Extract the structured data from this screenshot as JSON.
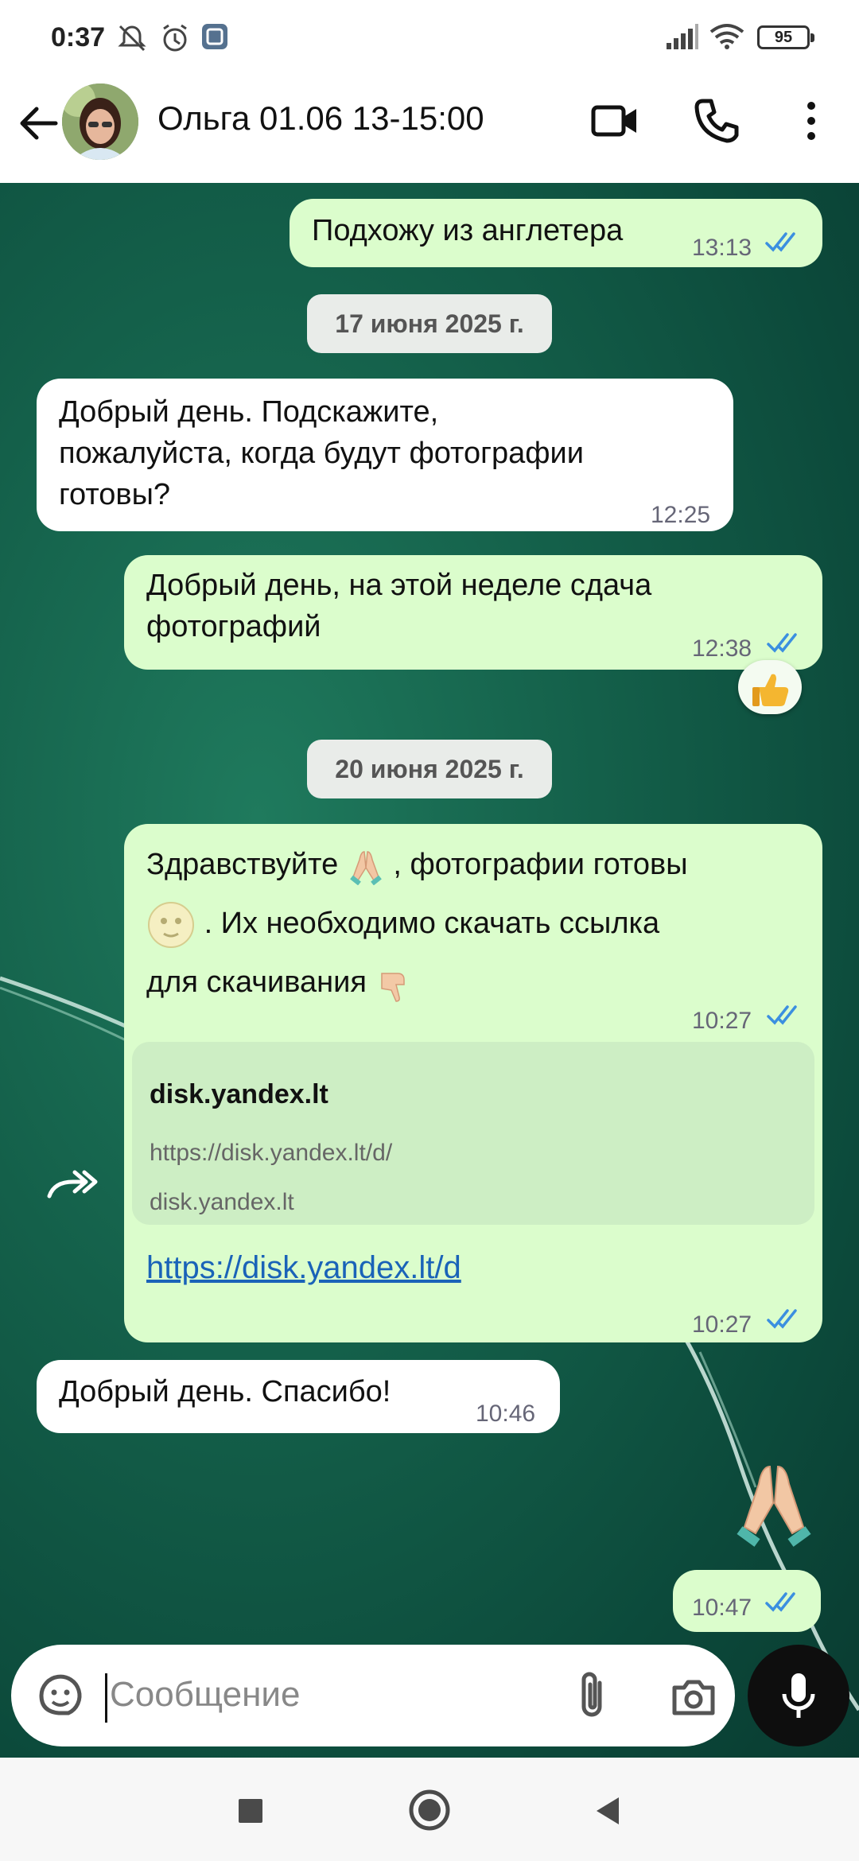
{
  "status_bar": {
    "time": "0:37",
    "battery": "95",
    "icons": [
      "notifications-off-icon",
      "alarm-icon",
      "gallery-icon",
      "signal-icon",
      "wifi-icon",
      "battery-icon"
    ]
  },
  "header": {
    "contact_name": "Ольга 01.06 13-15:00",
    "icons": [
      "back-arrow-icon",
      "avatar",
      "video-call-icon",
      "phone-icon",
      "more-vert-icon"
    ]
  },
  "messages": [
    {
      "direction": "out",
      "text": "Подхожу из англетера",
      "time": "13:13",
      "status": "read"
    },
    {
      "type": "date",
      "text": "17 июня 2025 г."
    },
    {
      "direction": "in",
      "text": "Добрый день.  Подскажите, пожалуйста,  когда будут фотографии готовы?",
      "lines": [
        "Добрый день.  Подскажите,",
        "пожалуйста,  когда будут фотографии",
        "готовы?"
      ],
      "time": "12:25"
    },
    {
      "direction": "out",
      "lines": [
        "Добрый день, на этой неделе сдача",
        "фотографий"
      ],
      "time": "12:38",
      "status": "read",
      "reaction": "thumbs-up"
    },
    {
      "type": "date",
      "text": "20 июня 2025 г."
    },
    {
      "direction": "out",
      "lines": [
        "Здравствуйте",
        ", фотографии готовы",
        ". Их необходимо скачать ссылка",
        "для скачивания"
      ],
      "time": "10:27",
      "status": "read"
    },
    {
      "direction": "out",
      "link_preview": {
        "title": "disk.yandex.lt",
        "url": "https://disk.yandex.lt/d/",
        "domain": "disk.yandex.lt"
      },
      "link": "https://disk.yandex.lt/d",
      "time": "10:27",
      "status": "read"
    },
    {
      "direction": "in",
      "text": "Добрый день. Спасибо!",
      "time": "10:46"
    },
    {
      "direction": "out",
      "emoji": "praying-hands",
      "time": "10:47",
      "status": "read"
    }
  ],
  "composer": {
    "placeholder": "Сообщение"
  },
  "nav_bar": {
    "buttons": [
      "recents-button",
      "home-button",
      "back-button"
    ]
  },
  "colors": {
    "outgoing_bubble": "#dbfdcc",
    "incoming_bubble": "#ffffff",
    "read_ticks": "#3b8fe0",
    "link": "#1a63b8",
    "wallpaper": "#14604a"
  }
}
